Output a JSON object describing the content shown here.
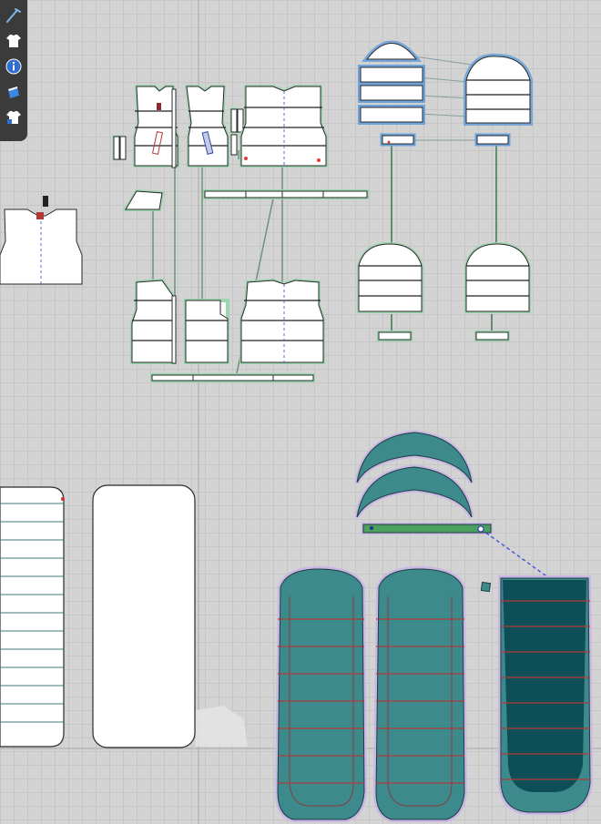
{
  "toolbar": {
    "tools": [
      {
        "name": "pen-tool-icon"
      },
      {
        "name": "garment-icon"
      },
      {
        "name": "info-icon"
      },
      {
        "name": "fabric-icon"
      },
      {
        "name": "avatar-garment-icon"
      }
    ]
  },
  "colors": {
    "canvas_bg": "#d3d3d3",
    "grid": "#c6c6c6",
    "toolbar_bg": "#3b3b3b",
    "piece_fill": "#ffffff",
    "piece_outline": "#2a2a2a",
    "selected_halo": "#9cc0e6",
    "seam_line": "#5f8f6f",
    "teal_fill": "#3d8a8d",
    "dark_teal_fill": "#0e4f57",
    "red_line": "#b03a3a",
    "purple_halo": "#c9b6e6"
  }
}
